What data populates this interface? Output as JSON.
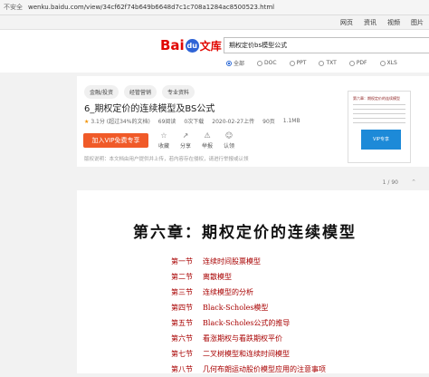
{
  "browser": {
    "security": "不安全",
    "url": "wenku.baidu.com/view/34cf62f74b649b6648d7c1c708a1284ac8500523.html"
  },
  "topnav": [
    "网页",
    "资讯",
    "视频",
    "图片"
  ],
  "header": {
    "logo_bai": "Bai",
    "logo_du": "du",
    "logo_wenku": "文库",
    "search_value": "期权定价bs模型公式",
    "filters": [
      "全部",
      "DOC",
      "PPT",
      "TXT",
      "PDF",
      "XLS"
    ],
    "filter_selected": "全部"
  },
  "doc": {
    "tags": [
      "金融/投资",
      "经管营销",
      "专业资料"
    ],
    "title": "6_期权定价的连续模型及BS公式",
    "rating": "3.1分 (超过34%的文档)",
    "reads": "69阅读",
    "downloads": "0次下载",
    "date": "2020-02-27上传",
    "pages": "90页",
    "size": "1.1MB",
    "vip_button": "加入VIP免费专享",
    "actions": [
      "收藏",
      "分享",
      "举报",
      "认领"
    ],
    "notice": "版权说明：本文档由用户提供并上传，若内容存在侵权，请进行举报或认领",
    "thumb_title": "第六章：期权定价的连续模型",
    "thumb_badge": "VIP专享"
  },
  "pager": {
    "current": "1",
    "total": "/ 90"
  },
  "page": {
    "chapter": "第六章：期权定价的连续模型",
    "sections": [
      {
        "no": "第一节",
        "title": "连续时间股票模型"
      },
      {
        "no": "第二节",
        "title": "离散模型"
      },
      {
        "no": "第三节",
        "title": "连续模型的分析"
      },
      {
        "no": "第四节",
        "title": "Black-Scholes模型"
      },
      {
        "no": "第五节",
        "title": "Black-Scholes公式的推导"
      },
      {
        "no": "第六节",
        "title": "看涨期权与看跌期权平价"
      },
      {
        "no": "第七节",
        "title": "二叉树模型和连续时间模型"
      },
      {
        "no": "第八节",
        "title": "几何布朗运动股价模型应用的注意事项"
      }
    ]
  }
}
